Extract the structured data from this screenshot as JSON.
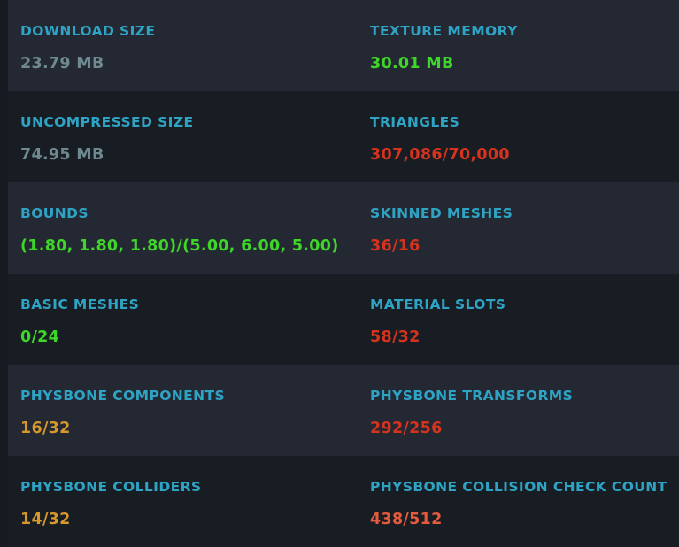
{
  "stats": {
    "download_size": {
      "label": "DOWNLOAD SIZE",
      "value": "23.79 MB"
    },
    "texture_memory": {
      "label": "TEXTURE MEMORY",
      "value": "30.01 MB"
    },
    "uncompressed_size": {
      "label": "UNCOMPRESSED SIZE",
      "value": "74.95 MB"
    },
    "triangles": {
      "label": "TRIANGLES",
      "value": "307,086/70,000"
    },
    "bounds": {
      "label": "BOUNDS",
      "value": "(1.80, 1.80, 1.80)/(5.00, 6.00, 5.00)"
    },
    "skinned_meshes": {
      "label": "SKINNED MESHES",
      "value": "36/16"
    },
    "basic_meshes": {
      "label": "BASIC MESHES",
      "value": "0/24"
    },
    "material_slots": {
      "label": "MATERIAL SLOTS",
      "value": "58/32"
    },
    "physbone_components": {
      "label": "PHYSBONE COMPONENTS",
      "value": "16/32"
    },
    "physbone_transforms": {
      "label": "PHYSBONE TRANSFORMS",
      "value": "292/256"
    },
    "physbone_colliders": {
      "label": "PHYSBONE COLLIDERS",
      "value": "14/32"
    },
    "physbone_collision_check_count": {
      "label": "PHYSBONE COLLISION CHECK COUNT",
      "value": "438/512"
    }
  },
  "colors": {
    "panel_background": "#161a21",
    "row_shaded": "#232833",
    "row_plain": "#181c23",
    "label": "#2fa3c4",
    "value_neutral": "#6e8990",
    "value_good": "#3ed628",
    "value_very_poor": "#d6331e",
    "value_medium": "#d6982d",
    "value_poor": "#e55a3c"
  }
}
